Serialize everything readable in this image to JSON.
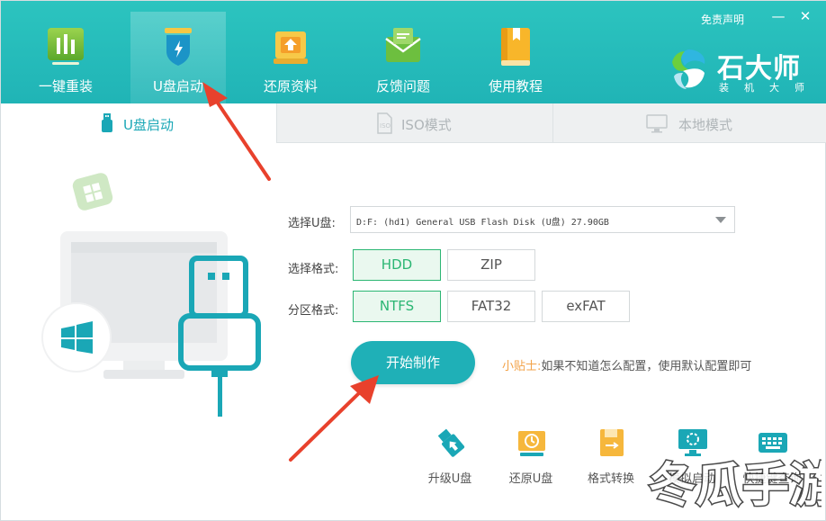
{
  "header": {
    "nav": [
      {
        "label": "一键重装",
        "icon": "chart-board-icon"
      },
      {
        "label": "U盘启动",
        "icon": "usb-shield-icon",
        "active": true
      },
      {
        "label": "还原资料",
        "icon": "restore-box-icon"
      },
      {
        "label": "反馈问题",
        "icon": "mail-feedback-icon"
      },
      {
        "label": "使用教程",
        "icon": "book-icon"
      }
    ],
    "disclaimer": "免责声明",
    "minimize": "—",
    "close": "✕",
    "brand": {
      "title": "石大师",
      "subtitle": "装机大师"
    }
  },
  "tabs": [
    {
      "label": "U盘启动",
      "icon": "usb-icon",
      "active": true
    },
    {
      "label": "ISO模式",
      "icon": "iso-file-icon"
    },
    {
      "label": "本地模式",
      "icon": "monitor-icon"
    }
  ],
  "form": {
    "select_label": "选择U盘:",
    "select_value": "D:F: (hd1) General USB Flash Disk  (U盘) 27.90GB",
    "format_label": "选择格式:",
    "formats": [
      {
        "label": "HDD",
        "selected": true
      },
      {
        "label": "ZIP"
      }
    ],
    "partition_label": "分区格式:",
    "partitions": [
      {
        "label": "NTFS",
        "selected": true
      },
      {
        "label": "FAT32"
      },
      {
        "label": "exFAT"
      }
    ],
    "start_button": "开始制作",
    "tip_key": "小贴士:",
    "tip_text": "如果不知道怎么配置，使用默认配置即可"
  },
  "tools": [
    {
      "label": "升级U盘",
      "icon": "usb-upgrade-icon"
    },
    {
      "label": "还原U盘",
      "icon": "usb-restore-icon"
    },
    {
      "label": "格式转换",
      "icon": "format-convert-icon"
    },
    {
      "label": "模拟启动",
      "icon": "simulate-boot-icon"
    },
    {
      "label": "快捷键查询",
      "icon": "keyboard-icon"
    }
  ],
  "watermark": "冬瓜手游",
  "colors": {
    "header": "#20b4b6",
    "accent": "#1aa7b6",
    "selected": "#2bb673",
    "tip": "#f2a247",
    "arrow": "#e8412c"
  }
}
